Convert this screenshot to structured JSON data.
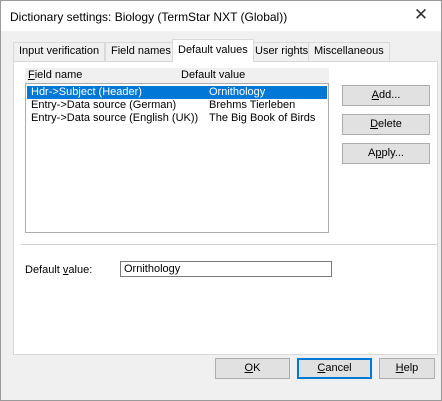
{
  "window": {
    "title": "Dictionary settings: Biology (TermStar NXT (Global))",
    "close_glyph": "✕"
  },
  "tabs": [
    {
      "label": "Input verification",
      "active": false
    },
    {
      "label": "Field names",
      "active": false
    },
    {
      "label": "Default values",
      "active": true
    },
    {
      "label": "User rights",
      "active": false
    },
    {
      "label": "Miscellaneous",
      "active": false
    }
  ],
  "list": {
    "columns": {
      "field_name": {
        "accel": "F",
        "rest": "ield name"
      },
      "default_value": "Default value"
    },
    "rows": [
      {
        "field": "Hdr->Subject (Header)",
        "value": "Ornithology",
        "selected": true
      },
      {
        "field": "Entry->Data source (German)",
        "value": "Brehms Tierleben",
        "selected": false
      },
      {
        "field": "Entry->Data source (English (UK))",
        "value": "The Big Book of Birds",
        "selected": false
      }
    ]
  },
  "side_buttons": {
    "add": {
      "accel": "A",
      "rest": "dd..."
    },
    "delete": {
      "accel": "D",
      "rest": "elete"
    },
    "apply": {
      "pre": "A",
      "accel": "p",
      "rest": "ply..."
    }
  },
  "default_value_field": {
    "label_pre": "Default ",
    "label_accel": "v",
    "label_post": "alue:",
    "value": "Ornithology"
  },
  "footer_buttons": {
    "ok": {
      "accel": "O",
      "rest": "K"
    },
    "cancel": {
      "accel": "C",
      "rest": "ancel"
    },
    "help": {
      "accel": "H",
      "rest": "elp"
    }
  },
  "colors": {
    "selection": "#0078d7",
    "button_face": "#e1e1e1",
    "dialog_bg": "#f0f0f0"
  }
}
